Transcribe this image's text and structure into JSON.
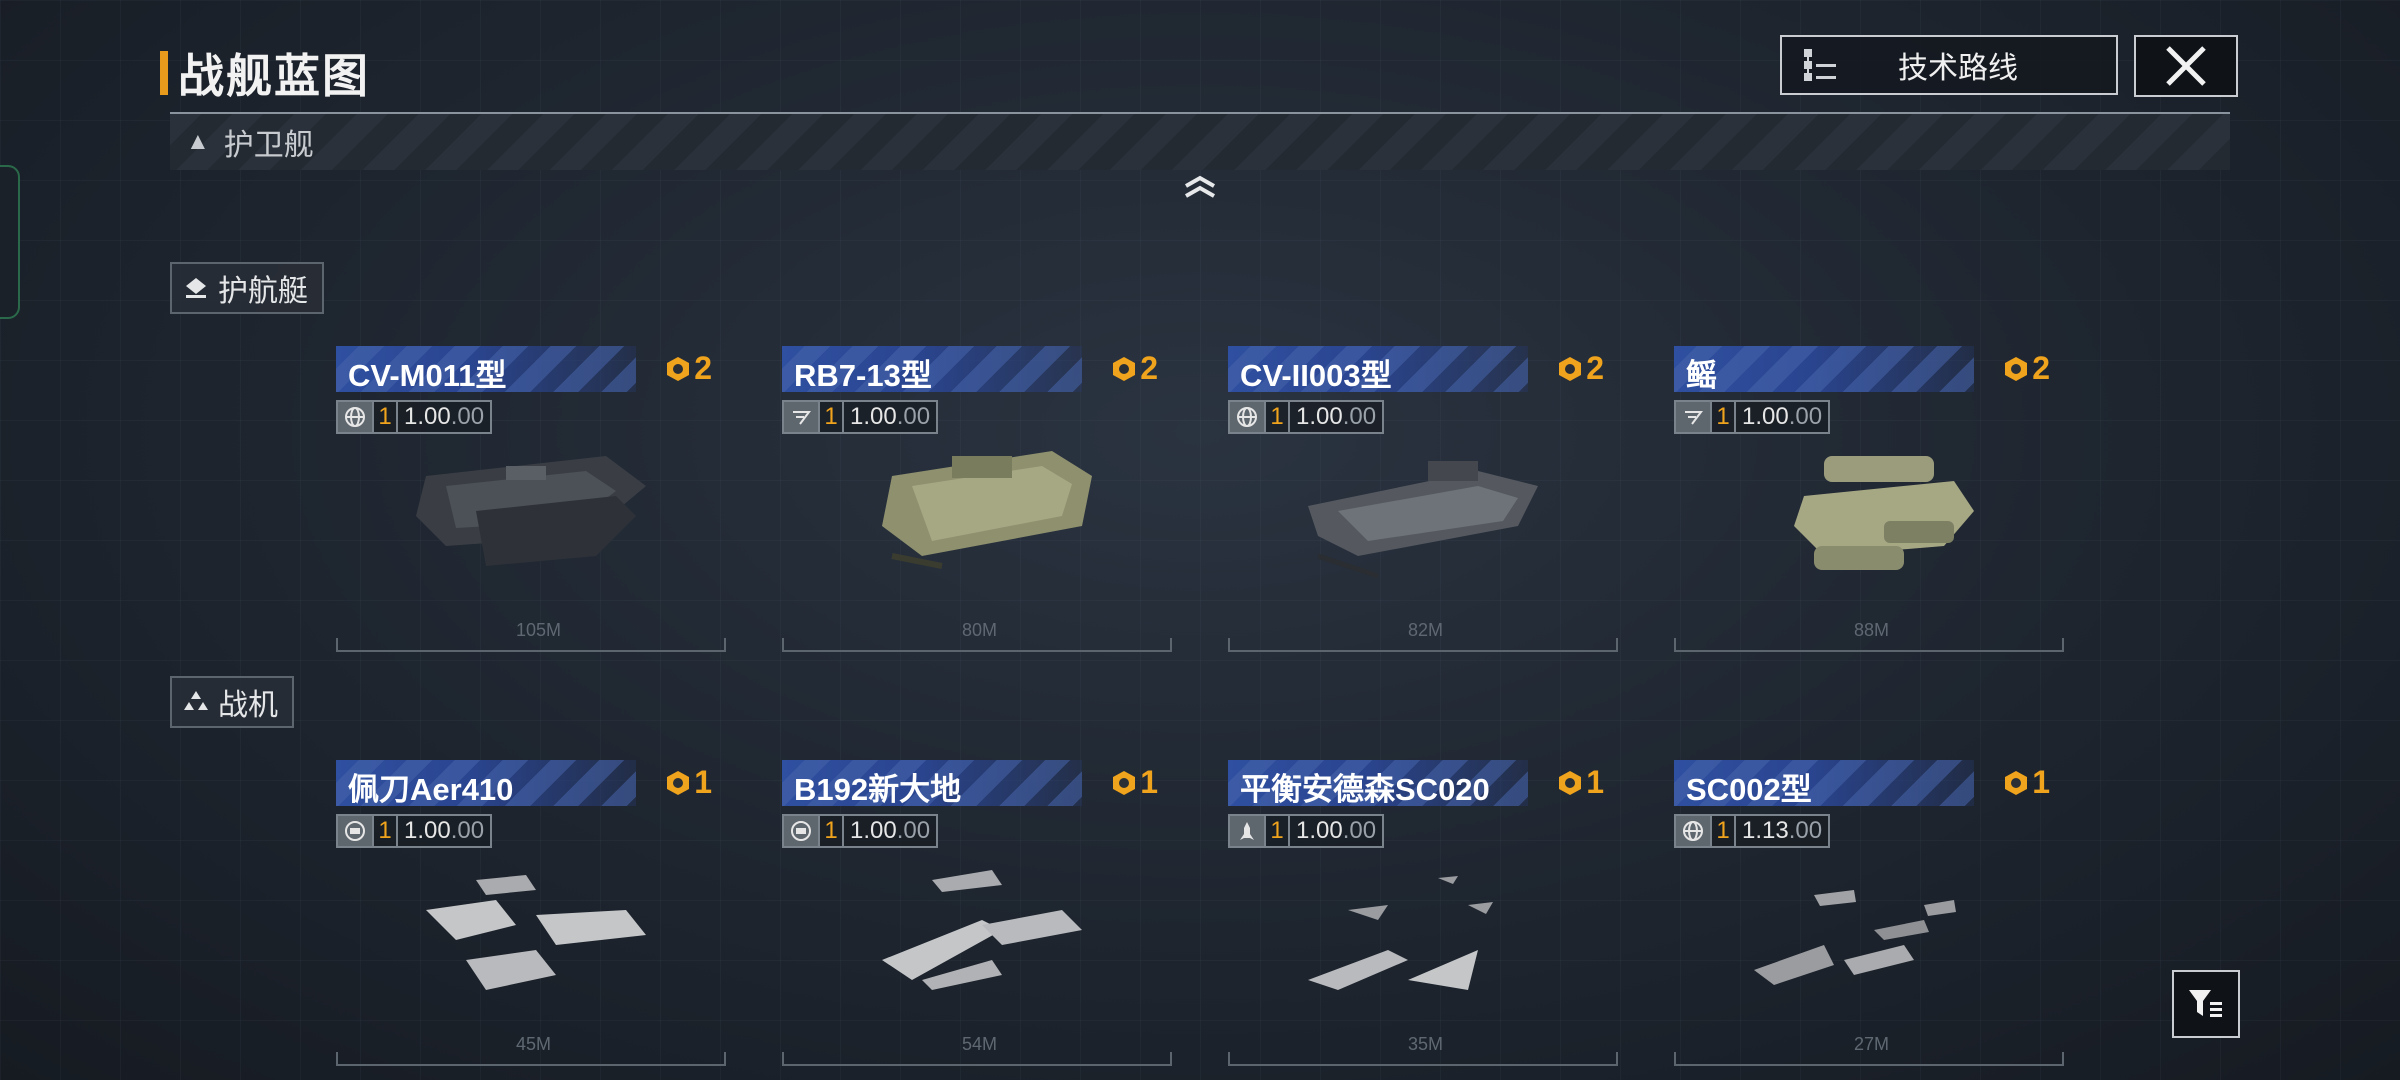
{
  "header": {
    "title": "战舰蓝图"
  },
  "tech_button": {
    "label": "技术路线"
  },
  "category": {
    "label": "护卫舰"
  },
  "sections": [
    {
      "label": "护航艇",
      "cards": [
        {
          "name": "CV-M011型",
          "cost": "2",
          "level": "1",
          "multiplier": "1.00",
          "decimals": ".00",
          "length": "105M",
          "type_icon": "globe-icon"
        },
        {
          "name": "RB7-13型",
          "cost": "2",
          "level": "1",
          "multiplier": "1.00",
          "decimals": ".00",
          "length": "80M",
          "type_icon": "speed-icon"
        },
        {
          "name": "CV-II003型",
          "cost": "2",
          "level": "1",
          "multiplier": "1.00",
          "decimals": ".00",
          "length": "82M",
          "type_icon": "globe-icon"
        },
        {
          "name": "鳐",
          "cost": "2",
          "level": "1",
          "multiplier": "1.00",
          "decimals": ".00",
          "length": "88M",
          "type_icon": "speed-icon"
        }
      ]
    },
    {
      "label": "战机",
      "cards": [
        {
          "name": "佩刀Aer410",
          "cost": "1",
          "level": "1",
          "multiplier": "1.00",
          "decimals": ".00",
          "length": "45M",
          "type_icon": "shield-icon"
        },
        {
          "name": "B192新大地",
          "cost": "1",
          "level": "1",
          "multiplier": "1.00",
          "decimals": ".00",
          "length": "54M",
          "type_icon": "shield-icon"
        },
        {
          "name": "平衡安德森SC020",
          "cost": "1",
          "level": "1",
          "multiplier": "1.00",
          "decimals": ".00",
          "length": "35M",
          "type_icon": "missile-icon"
        },
        {
          "name": "SC002型",
          "cost": "1",
          "level": "1",
          "multiplier": "1.13",
          "decimals": ".00",
          "length": "27M",
          "type_icon": "globe-icon"
        }
      ]
    }
  ],
  "colors": {
    "accent": "#e89a1c",
    "name_bar": "#2f4fa0",
    "cost": "#f0a31c"
  }
}
